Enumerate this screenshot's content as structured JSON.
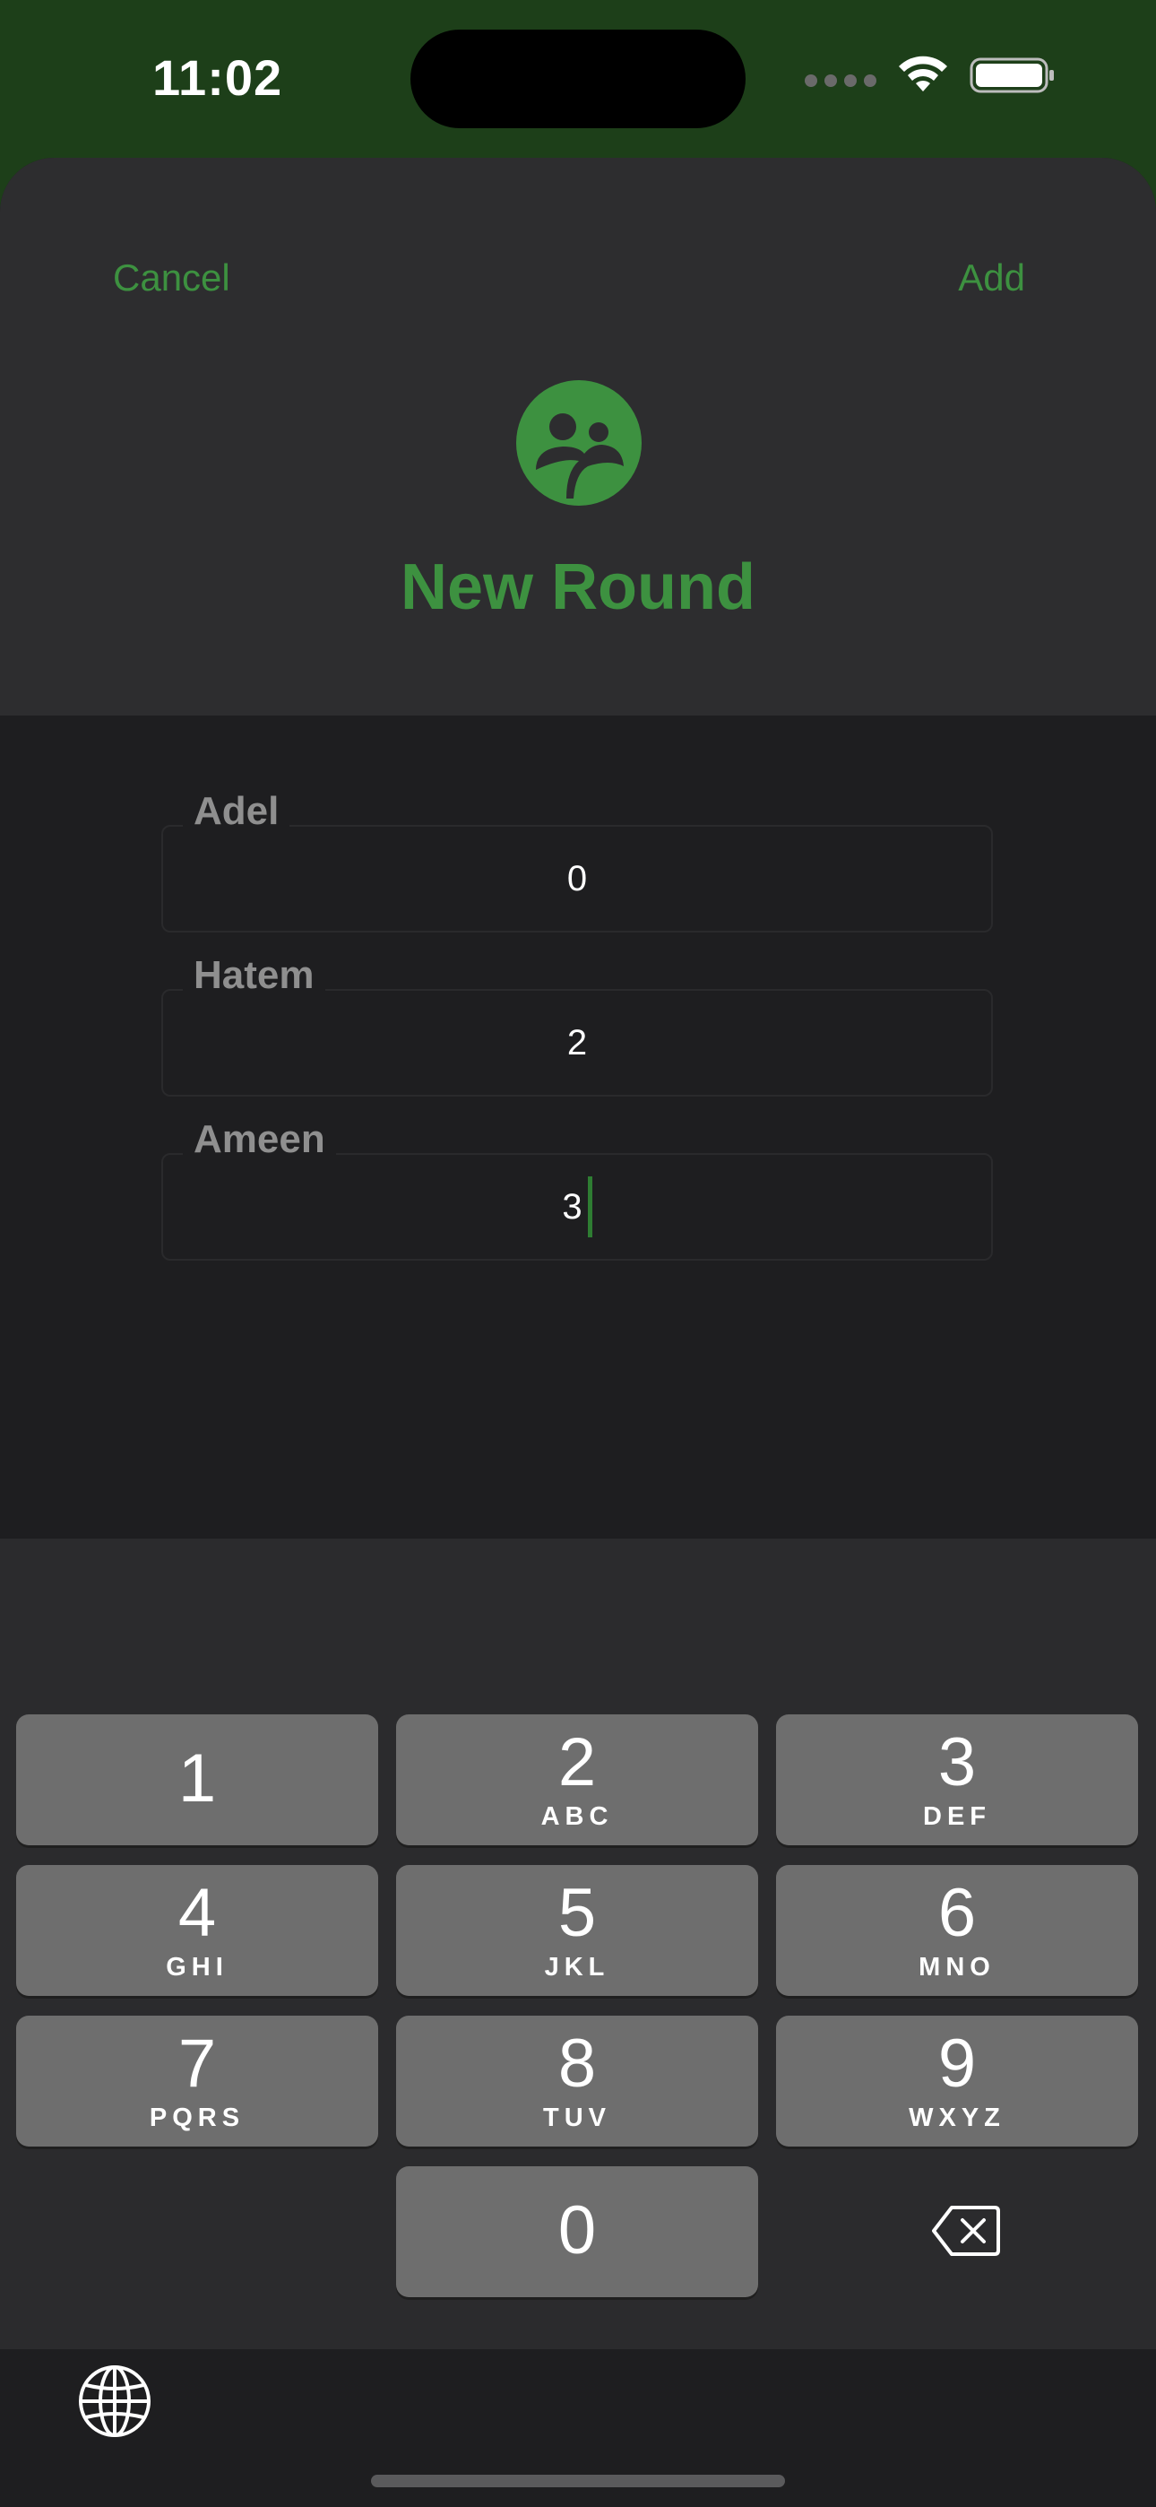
{
  "status_bar": {
    "time": "11:02"
  },
  "header": {
    "cancel_label": "Cancel",
    "add_label": "Add",
    "title": "New Round",
    "icon": "players-group-icon",
    "accent_color": "#3d9140"
  },
  "fields": [
    {
      "label": "Adel",
      "value": "0"
    },
    {
      "label": "Hatem",
      "value": "2"
    },
    {
      "label": "Ameen",
      "value": "3",
      "focused": true
    }
  ],
  "keyboard": {
    "keys": [
      {
        "digit": "1",
        "letters": ""
      },
      {
        "digit": "2",
        "letters": "ABC"
      },
      {
        "digit": "3",
        "letters": "DEF"
      },
      {
        "digit": "4",
        "letters": "GHI"
      },
      {
        "digit": "5",
        "letters": "JKL"
      },
      {
        "digit": "6",
        "letters": "MNO"
      },
      {
        "digit": "7",
        "letters": "PQRS"
      },
      {
        "digit": "8",
        "letters": "TUV"
      },
      {
        "digit": "9",
        "letters": "WXYZ"
      },
      {
        "digit": "0",
        "letters": ""
      }
    ],
    "delete_icon": "backspace-icon",
    "globe_icon": "globe-icon"
  }
}
